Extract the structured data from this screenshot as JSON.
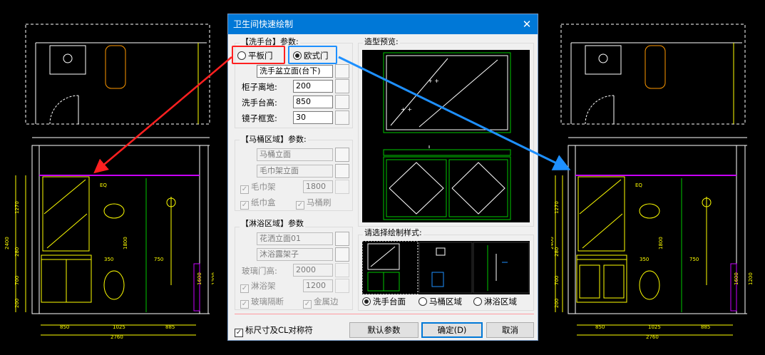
{
  "dialog": {
    "title": "卫生间快速绘制",
    "close_glyph": "✕",
    "basin_group": {
      "title": "【洗手台】参数:",
      "door_flat": "平板门",
      "door_euro": "欧式门",
      "elevation": "洗手盆立面(台下)",
      "cabinet_height_label": "柜子离地:",
      "cabinet_height_value": "200",
      "counter_height_label": "洗手台高:",
      "counter_height_value": "850",
      "mirror_frame_label": "镜子框宽:",
      "mirror_frame_value": "30"
    },
    "toilet_group": {
      "title": "【马桶区域】参数:",
      "toilet_elevation": "马桶立面",
      "towel_rack_elevation": "毛巾架立面",
      "towel_rack_label": "毛巾架",
      "towel_rack_value": "1800",
      "tissue_box_label": "纸巾盒",
      "toilet_brush_label": "马桶刷"
    },
    "shower_group": {
      "title": "【淋浴区域】参数",
      "shower_elevation": "花洒立面01",
      "shower_rack": "沐浴露架子",
      "glass_door_label": "玻璃门高:",
      "glass_door_value": "2000",
      "shower_shelf_label": "淋浴架",
      "shower_shelf_value": "1200",
      "glass_partition_label": "玻璃隔断",
      "metal_edge_label": "金属边"
    },
    "preview_group": {
      "title": "造型预览:"
    },
    "style_group": {
      "title": "请选择绘制样式:",
      "option_basin": "洗手台面",
      "option_toilet": "马桶区域",
      "option_shower": "淋浴区域"
    },
    "dimension_checkbox": "标尺寸及CL对称符",
    "buttons": {
      "defaults": "默认参数",
      "ok": "确定(D)",
      "cancel": "取消"
    }
  },
  "cad_left": {
    "dims": [
      "1270",
      "280",
      "700",
      "200",
      "2400",
      "850",
      "1025",
      "885",
      "2760",
      "1200",
      "1600",
      "1800",
      "350",
      "750",
      "EQ"
    ]
  },
  "cad_right": {
    "dims": [
      "1270",
      "280",
      "700",
      "200",
      "2400",
      "850",
      "1025",
      "885",
      "2760",
      "1200",
      "1600",
      "1800",
      "350",
      "750",
      "EQ"
    ]
  },
  "colors": {
    "titlebar": "#0078d7",
    "cad_yellow": "#ffff00",
    "cad_green": "#00c800",
    "cad_magenta": "#c800ff",
    "highlight_red": "#ff2020",
    "highlight_blue": "#1e90ff"
  }
}
